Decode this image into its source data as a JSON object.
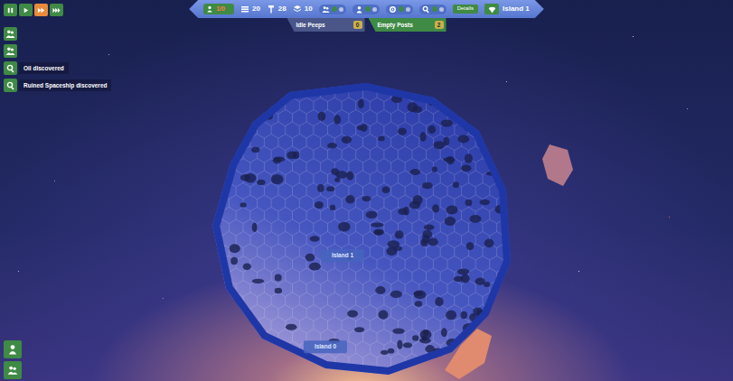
{
  "speed_controls": [
    {
      "selected": false
    },
    {
      "selected": false
    },
    {
      "selected": true
    },
    {
      "selected": false
    }
  ],
  "top_bar": {
    "population": "1/0",
    "resources": [
      {
        "value": "20"
      },
      {
        "value": "28"
      },
      {
        "value": "10"
      }
    ],
    "details_button": "Details",
    "island": "Island 1"
  },
  "status": [
    {
      "label": "Idle Peeps",
      "count": "0",
      "color": "#4a5688"
    },
    {
      "label": "Empty Posts",
      "count": "2",
      "color": "#3f8a45"
    }
  ],
  "notifications": [
    {
      "text": "Oil discovered"
    },
    {
      "text": "Ruined Spaceship discovered"
    }
  ],
  "map_labels": [
    {
      "text": "Island 1"
    },
    {
      "text": "Island 0"
    }
  ]
}
